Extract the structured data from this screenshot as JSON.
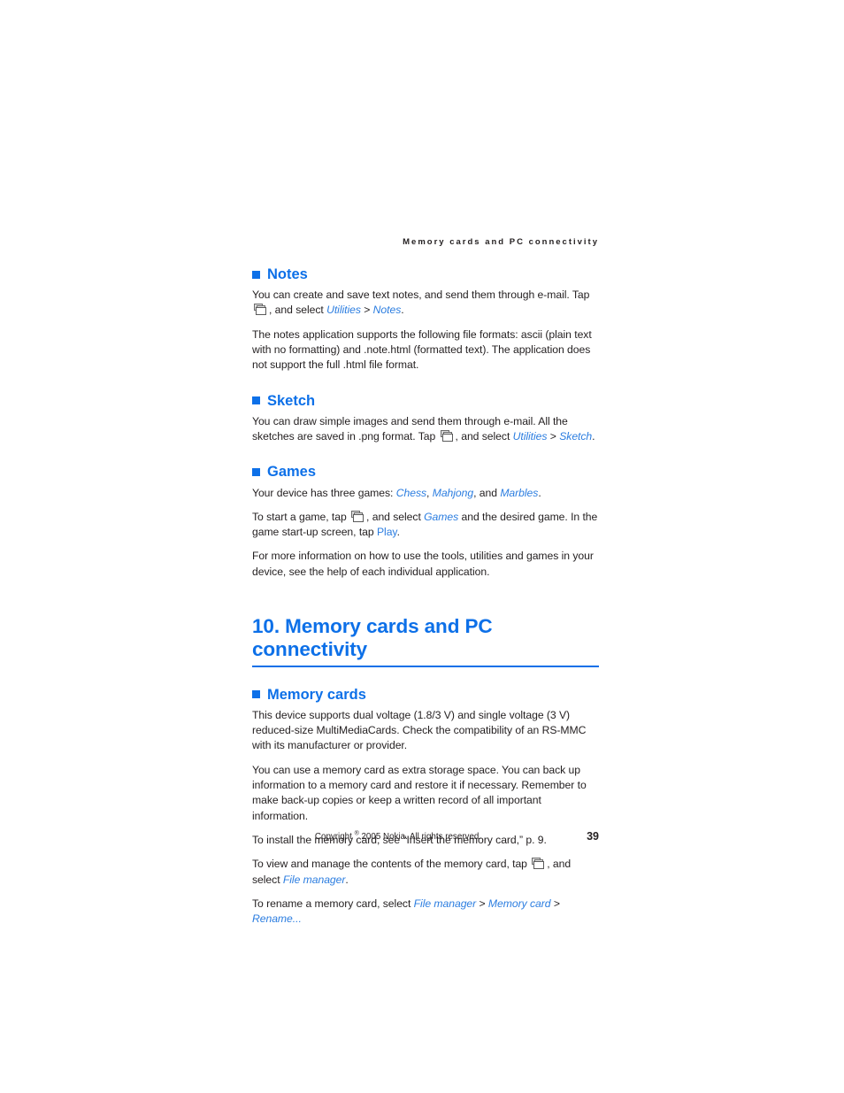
{
  "running_header": "Memory cards and PC connectivity",
  "sections": [
    {
      "id": "notes",
      "heading": "Notes",
      "paragraphs": [
        {
          "id": "notes-p1",
          "runs": [
            {
              "t": "You can create and save text notes, and send them through e-mail. Tap ",
              "s": "plain"
            },
            {
              "t": "desk-icon",
              "s": "icon"
            },
            {
              "t": ", and select ",
              "s": "plain"
            },
            {
              "t": "Utilities",
              "s": "ui-italic"
            },
            {
              "t": " > ",
              "s": "gt"
            },
            {
              "t": "Notes",
              "s": "ui-italic"
            },
            {
              "t": ".",
              "s": "plain"
            }
          ]
        },
        {
          "id": "notes-p2",
          "runs": [
            {
              "t": "The notes application supports the following file formats: ascii (plain text with no formatting) and .note.html (formatted text). The application does not support the full .html file format.",
              "s": "plain"
            }
          ]
        }
      ]
    },
    {
      "id": "sketch",
      "heading": "Sketch",
      "paragraphs": [
        {
          "id": "sketch-p1",
          "runs": [
            {
              "t": "You can draw simple images and send them through e-mail. All the sketches are saved in .png format. Tap ",
              "s": "plain"
            },
            {
              "t": "desk-icon",
              "s": "icon"
            },
            {
              "t": ", and select ",
              "s": "plain"
            },
            {
              "t": "Utilities",
              "s": "ui-italic"
            },
            {
              "t": " > ",
              "s": "gt"
            },
            {
              "t": "Sketch",
              "s": "ui-italic"
            },
            {
              "t": ".",
              "s": "plain"
            }
          ]
        }
      ]
    },
    {
      "id": "games",
      "heading": "Games",
      "paragraphs": [
        {
          "id": "games-p1",
          "runs": [
            {
              "t": "Your device has three games: ",
              "s": "plain"
            },
            {
              "t": "Chess",
              "s": "ui-italic"
            },
            {
              "t": ", ",
              "s": "plain"
            },
            {
              "t": "Mahjong",
              "s": "ui-italic"
            },
            {
              "t": ", and ",
              "s": "plain"
            },
            {
              "t": "Marbles",
              "s": "ui-italic"
            },
            {
              "t": ".",
              "s": "plain"
            }
          ]
        },
        {
          "id": "games-p2",
          "runs": [
            {
              "t": "To start a game, tap ",
              "s": "plain"
            },
            {
              "t": "desk-icon",
              "s": "icon"
            },
            {
              "t": ", and select ",
              "s": "plain"
            },
            {
              "t": "Games",
              "s": "ui-italic"
            },
            {
              "t": " and the desired game. In the game start-up screen, tap ",
              "s": "plain"
            },
            {
              "t": "Play",
              "s": "ui-plain"
            },
            {
              "t": ".",
              "s": "plain"
            }
          ]
        },
        {
          "id": "games-p3",
          "runs": [
            {
              "t": "For more information on how to use the tools, utilities and games in your device, see the help of each individual application.",
              "s": "plain"
            }
          ]
        }
      ]
    }
  ],
  "chapter": {
    "number": "10.",
    "title": "10. Memory cards and PC connectivity"
  },
  "chapter_sections": [
    {
      "id": "memory-cards",
      "heading": "Memory cards",
      "paragraphs": [
        {
          "id": "mc-p1",
          "runs": [
            {
              "t": "This device supports dual voltage (1.8/3 V) and single voltage (3 V) reduced-size MultiMediaCards. Check the compatibility of an RS-MMC with its manufacturer or provider.",
              "s": "plain"
            }
          ]
        },
        {
          "id": "mc-p2",
          "runs": [
            {
              "t": "You can use a memory card as extra storage space. You can back up information to a memory card and restore it if necessary. Remember to make back-up copies or keep a written record of all important information.",
              "s": "plain"
            }
          ]
        },
        {
          "id": "mc-p3",
          "runs": [
            {
              "t": "To install the memory card, see “Insert the memory card,” p. 9.",
              "s": "plain"
            }
          ]
        },
        {
          "id": "mc-p4",
          "runs": [
            {
              "t": "To view and manage the contents of the memory card, tap ",
              "s": "plain"
            },
            {
              "t": "desk-icon",
              "s": "icon"
            },
            {
              "t": ", and select ",
              "s": "plain"
            },
            {
              "t": "File manager",
              "s": "ui-italic"
            },
            {
              "t": ".",
              "s": "plain"
            }
          ]
        },
        {
          "id": "mc-p5",
          "runs": [
            {
              "t": "To rename a memory card, select ",
              "s": "plain"
            },
            {
              "t": "File manager",
              "s": "ui-italic"
            },
            {
              "t": " > ",
              "s": "gt"
            },
            {
              "t": "Memory card",
              "s": "ui-italic"
            },
            {
              "t": " > ",
              "s": "gt"
            },
            {
              "t": "Rename...",
              "s": "ui-italic"
            }
          ]
        }
      ]
    }
  ],
  "footer": {
    "copyright_pre": "Copyright ",
    "copyright_symbol": "®",
    "copyright_post": " 2005 Nokia. All rights reserved.",
    "page_number": "39"
  },
  "colors": {
    "accent_blue": "#0d70e8",
    "link_blue": "#2b7de0",
    "body_text": "#231f20"
  }
}
